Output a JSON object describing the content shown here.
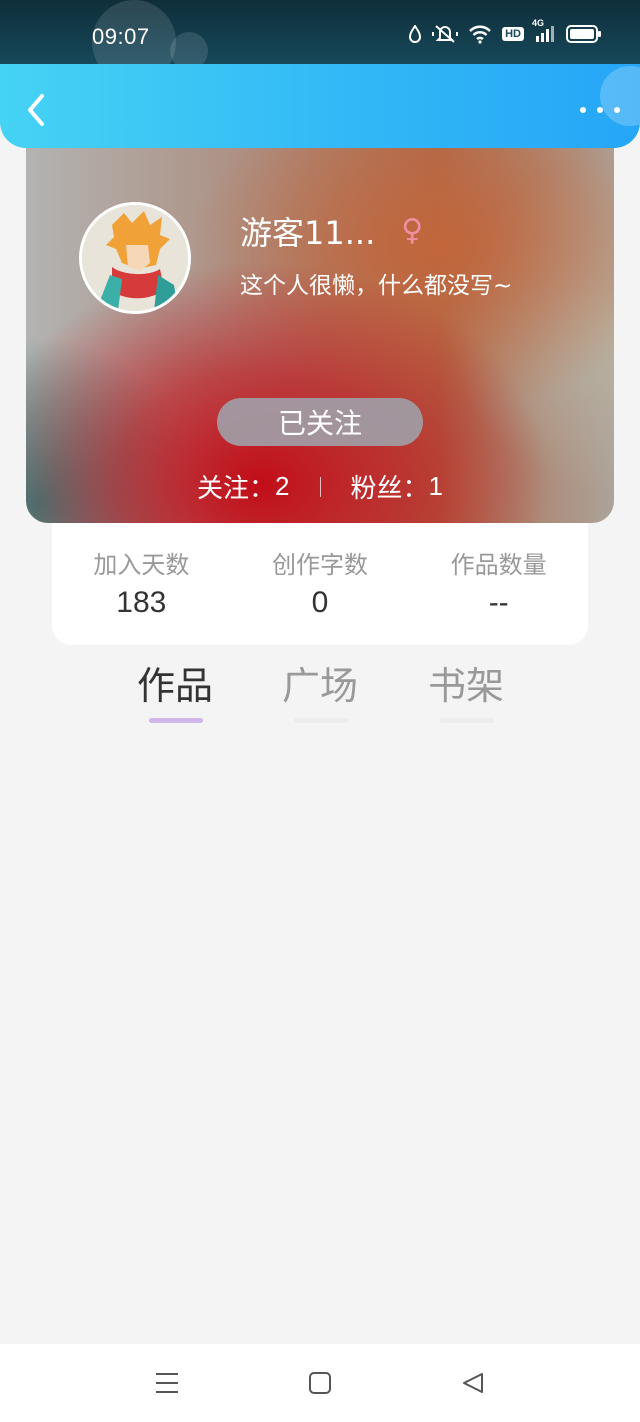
{
  "status_bar": {
    "time": "09:07",
    "hd_label": "HD",
    "network_label": "4G",
    "icons": [
      "water-drop-icon",
      "mute-icon",
      "wifi-icon",
      "hd-badge",
      "signal-icon",
      "battery-icon"
    ]
  },
  "header": {
    "gradient": [
      "#45d3f4",
      "#26a6f7"
    ],
    "back_icon": "chevron-left-icon",
    "more_icon": "more-dots-icon"
  },
  "profile": {
    "username": "游客11...",
    "gender_symbol": "♀",
    "bio": "这个人很懒，什么都没写~",
    "follow_label": "已关注",
    "following_label": "关注：",
    "following_count": "2",
    "fans_label": "粉丝：",
    "fans_count": "1"
  },
  "info": {
    "items": [
      {
        "label": "加入天数",
        "value": "183"
      },
      {
        "label": "创作字数",
        "value": "0"
      },
      {
        "label": "作品数量",
        "value": "--"
      }
    ]
  },
  "tabs": {
    "items": [
      {
        "label": "作品",
        "active": true
      },
      {
        "label": "广场",
        "active": false
      },
      {
        "label": "书架",
        "active": false
      }
    ],
    "active_color": "#d0b5e8"
  },
  "nav": {
    "icons": [
      "menu-icon",
      "home-square-icon",
      "back-triangle-icon"
    ]
  }
}
